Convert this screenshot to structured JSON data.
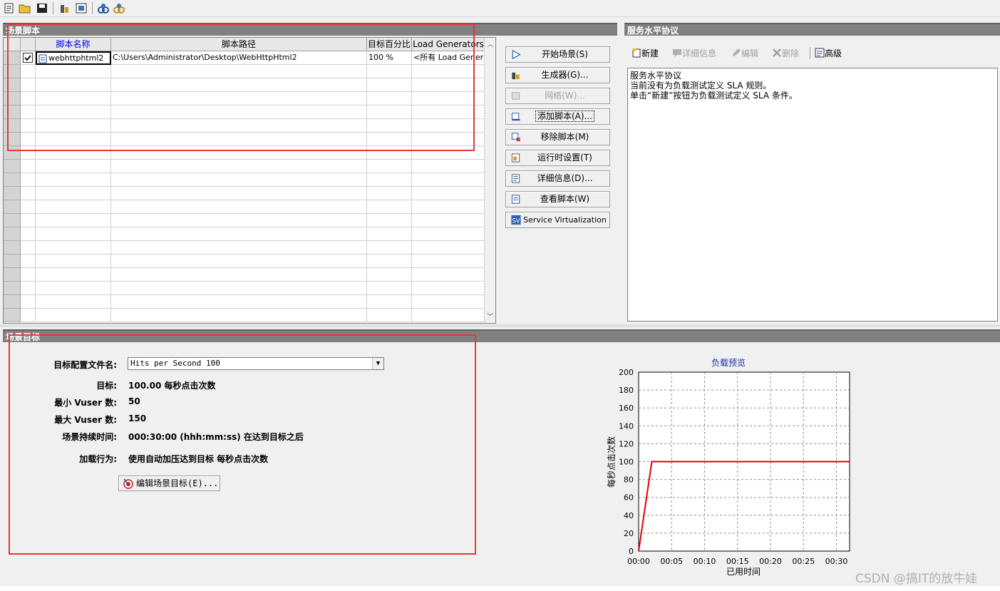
{
  "toolbar": {
    "icons": [
      "new-scenario-icon",
      "open-icon",
      "save-icon",
      "generators-icon",
      "vusers-icon",
      "analysis-icon",
      "tune-icon"
    ]
  },
  "scenario_scripts": {
    "title": "场景脚本",
    "columns": [
      "脚本名称",
      "脚本路径",
      "目标百分比",
      "Load Generators"
    ],
    "rows": [
      {
        "checked": true,
        "name": "webhttphtml2",
        "path": "C:\\Users\\Administrator\\Desktop\\WebHttpHtml2",
        "percent": "100 %",
        "load_generators": "<所有 Load Generators>"
      }
    ]
  },
  "side_buttons": [
    {
      "label": "开始场景(S)",
      "icon": "play-icon"
    },
    {
      "label": "生成器(G)...",
      "icon": "generators-icon"
    },
    {
      "label": "网络(W)...",
      "icon": "network-icon",
      "disabled": true
    },
    {
      "label": "添加脚本(A)...",
      "icon": "add-script-icon",
      "focused": true
    },
    {
      "label": "移除脚本(M)",
      "icon": "remove-script-icon"
    },
    {
      "label": "运行时设置(T)",
      "icon": "runtime-settings-icon"
    },
    {
      "label": "详细信息(D)...",
      "icon": "details-icon"
    },
    {
      "label": "查看脚本(W)",
      "icon": "view-script-icon"
    },
    {
      "label": "Service Virtualization",
      "icon": "sv-icon"
    }
  ],
  "sla": {
    "title": "服务水平协议",
    "toolbar": {
      "new": "新建",
      "details": "详细信息",
      "edit": "编辑",
      "delete": "删除",
      "advanced": "高级"
    },
    "lines": [
      "服务水平协议",
      "当前没有为负载测试定义 SLA 规则。",
      "单击“新建”按钮为负载测试定义 SLA 条件。"
    ]
  },
  "scenario_goal": {
    "title": "场景目标",
    "profile_label": "目标配置文件名:",
    "profile_value": "Hits per Second 100",
    "target_label": "目标:",
    "target_value": "100.00 每秒点击次数",
    "min_vuser_label": "最小 Vuser 数:",
    "min_vuser_value": "50",
    "max_vuser_label": "最大 Vuser 数:",
    "max_vuser_value": "150",
    "duration_label": "场景持续时间:",
    "duration_value": "000:30:00 (hhh:mm:ss) 在达到目标之后",
    "load_behavior_label": "加载行为:",
    "load_behavior_value": "使用自动加压达到目标 每秒点击次数",
    "edit_button": "编辑场景目标(E)..."
  },
  "chart_data": {
    "type": "line",
    "title": "负载预览",
    "xlabel": "已用时间",
    "ylabel": "每秒点击次数",
    "x_ticks": [
      "00:00",
      "00:05",
      "00:10",
      "00:15",
      "00:20",
      "00:25",
      "00:30"
    ],
    "y_ticks": [
      0,
      20,
      40,
      60,
      80,
      100,
      120,
      140,
      160,
      180,
      200
    ],
    "ylim": [
      0,
      200
    ],
    "xlim_minutes": [
      0,
      32
    ],
    "series": [
      {
        "color": "#e00000",
        "x_minutes": [
          0,
          2,
          32
        ],
        "values": [
          0,
          100,
          100
        ]
      }
    ],
    "grid": true
  },
  "watermark": "CSDN @搞IT的放牛娃"
}
